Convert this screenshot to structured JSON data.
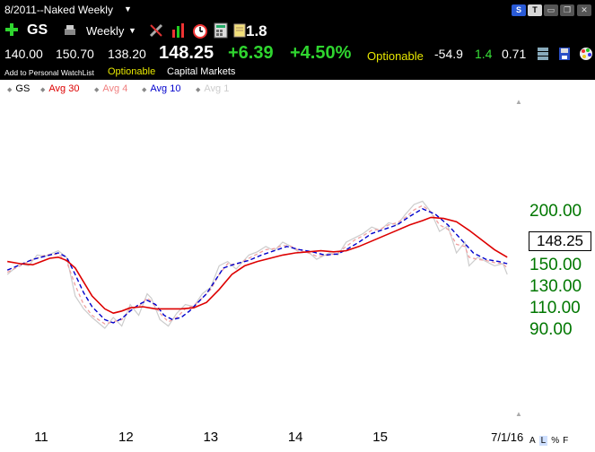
{
  "window": {
    "title": "8/2011--Naked Weekly"
  },
  "toolbar": {
    "symbol": "GS",
    "period": "Weekly",
    "rs_value": "1.8"
  },
  "quote": {
    "values": [
      "140.00",
      "150.70",
      "138.20"
    ],
    "last": "148.25",
    "change": "+6.39",
    "pct_change": "+4.50%",
    "optionable": "Optionable",
    "val1": "-54.9",
    "val2": "1.4",
    "val3": "0.71"
  },
  "watch": {
    "add_label": "Add to Personal WatchList",
    "optionable": "Optionable",
    "sector": "Capital Markets"
  },
  "legend": {
    "symbol": "GS",
    "avg30": "Avg 30",
    "avg4": "Avg 4",
    "avg10": "Avg 10",
    "avg1": "Avg 1"
  },
  "chart_controls": {
    "a": "A",
    "l": "L",
    "pct": "%",
    "f": "F"
  },
  "colors": {
    "avg30": "#dd0000",
    "avg10": "#0000cc",
    "avg4": "#f0a0a0",
    "avg1": "#cccccc",
    "axis_text": "#007700",
    "gain": "#2fd52f",
    "optionable": "#e8e800"
  },
  "chart_data": {
    "type": "line",
    "price_box": "148.25",
    "yticks": [
      {
        "value": 200,
        "label": "200.00"
      },
      {
        "value": 150,
        "label": "150.00"
      },
      {
        "value": 130,
        "label": "130.00"
      },
      {
        "value": 110,
        "label": "110.00"
      },
      {
        "value": 90,
        "label": "90.00"
      }
    ],
    "xticks": [
      {
        "x": 2011,
        "label": "11"
      },
      {
        "x": 2012,
        "label": "12"
      },
      {
        "x": 2013,
        "label": "13"
      },
      {
        "x": 2014,
        "label": "14"
      },
      {
        "x": 2015,
        "label": "15"
      },
      {
        "x": 2016.5,
        "label": "7/1/16"
      }
    ],
    "series": [
      {
        "name": "Avg 1",
        "key": "avg1",
        "points": [
          [
            2010.6,
            140
          ],
          [
            2010.75,
            150
          ],
          [
            2010.85,
            148
          ],
          [
            2010.95,
            158
          ],
          [
            2011.05,
            157
          ],
          [
            2011.2,
            162
          ],
          [
            2011.3,
            156
          ],
          [
            2011.4,
            120
          ],
          [
            2011.5,
            108
          ],
          [
            2011.6,
            100
          ],
          [
            2011.75,
            90
          ],
          [
            2011.85,
            100
          ],
          [
            2011.95,
            92
          ],
          [
            2012.05,
            112
          ],
          [
            2012.15,
            102
          ],
          [
            2012.25,
            122
          ],
          [
            2012.3,
            118
          ],
          [
            2012.4,
            98
          ],
          [
            2012.5,
            92
          ],
          [
            2012.6,
            104
          ],
          [
            2012.7,
            112
          ],
          [
            2012.8,
            110
          ],
          [
            2012.9,
            122
          ],
          [
            2013.0,
            128
          ],
          [
            2013.1,
            148
          ],
          [
            2013.2,
            152
          ],
          [
            2013.3,
            145
          ],
          [
            2013.45,
            158
          ],
          [
            2013.55,
            161
          ],
          [
            2013.65,
            166
          ],
          [
            2013.75,
            162
          ],
          [
            2013.85,
            170
          ],
          [
            2013.95,
            166
          ],
          [
            2014.05,
            160
          ],
          [
            2014.15,
            161
          ],
          [
            2014.25,
            154
          ],
          [
            2014.4,
            160
          ],
          [
            2014.5,
            158
          ],
          [
            2014.6,
            170
          ],
          [
            2014.7,
            174
          ],
          [
            2014.8,
            178
          ],
          [
            2014.9,
            184
          ],
          [
            2015.0,
            181
          ],
          [
            2015.1,
            188
          ],
          [
            2015.2,
            186
          ],
          [
            2015.3,
            196
          ],
          [
            2015.4,
            205
          ],
          [
            2015.5,
            208
          ],
          [
            2015.6,
            198
          ],
          [
            2015.7,
            180
          ],
          [
            2015.8,
            185
          ],
          [
            2015.9,
            160
          ],
          [
            2016.0,
            170
          ],
          [
            2016.05,
            148
          ],
          [
            2016.15,
            156
          ],
          [
            2016.25,
            152
          ],
          [
            2016.35,
            148
          ],
          [
            2016.45,
            150
          ],
          [
            2016.5,
            140
          ]
        ]
      },
      {
        "name": "Avg 4",
        "key": "avg4",
        "points": [
          [
            2010.6,
            142
          ],
          [
            2010.75,
            148
          ],
          [
            2010.85,
            152
          ],
          [
            2010.95,
            155
          ],
          [
            2011.05,
            158
          ],
          [
            2011.2,
            159
          ],
          [
            2011.3,
            152
          ],
          [
            2011.4,
            130
          ],
          [
            2011.5,
            112
          ],
          [
            2011.6,
            102
          ],
          [
            2011.75,
            94
          ],
          [
            2011.85,
            96
          ],
          [
            2011.95,
            98
          ],
          [
            2012.05,
            108
          ],
          [
            2012.15,
            110
          ],
          [
            2012.25,
            118
          ],
          [
            2012.3,
            115
          ],
          [
            2012.4,
            104
          ],
          [
            2012.5,
            96
          ],
          [
            2012.6,
            100
          ],
          [
            2012.7,
            108
          ],
          [
            2012.8,
            111
          ],
          [
            2012.9,
            118
          ],
          [
            2013.0,
            126
          ],
          [
            2013.1,
            140
          ],
          [
            2013.2,
            150
          ],
          [
            2013.3,
            149
          ],
          [
            2013.45,
            155
          ],
          [
            2013.55,
            159
          ],
          [
            2013.65,
            163
          ],
          [
            2013.75,
            164
          ],
          [
            2013.85,
            167
          ],
          [
            2013.95,
            166
          ],
          [
            2014.05,
            162
          ],
          [
            2014.15,
            160
          ],
          [
            2014.25,
            157
          ],
          [
            2014.4,
            158
          ],
          [
            2014.5,
            160
          ],
          [
            2014.6,
            166
          ],
          [
            2014.7,
            172
          ],
          [
            2014.8,
            176
          ],
          [
            2014.9,
            181
          ],
          [
            2015.0,
            182
          ],
          [
            2015.1,
            186
          ],
          [
            2015.2,
            188
          ],
          [
            2015.3,
            193
          ],
          [
            2015.4,
            200
          ],
          [
            2015.5,
            204
          ],
          [
            2015.6,
            198
          ],
          [
            2015.7,
            186
          ],
          [
            2015.8,
            182
          ],
          [
            2015.9,
            168
          ],
          [
            2016.0,
            166
          ],
          [
            2016.05,
            156
          ],
          [
            2016.15,
            154
          ],
          [
            2016.25,
            153
          ],
          [
            2016.35,
            151
          ],
          [
            2016.45,
            150
          ],
          [
            2016.5,
            146
          ]
        ]
      },
      {
        "name": "Avg 10",
        "key": "avg10",
        "points": [
          [
            2010.6,
            144
          ],
          [
            2010.75,
            149
          ],
          [
            2010.9,
            154
          ],
          [
            2011.05,
            157
          ],
          [
            2011.2,
            160
          ],
          [
            2011.3,
            156
          ],
          [
            2011.4,
            140
          ],
          [
            2011.5,
            123
          ],
          [
            2011.6,
            110
          ],
          [
            2011.75,
            98
          ],
          [
            2011.85,
            95
          ],
          [
            2011.95,
            99
          ],
          [
            2012.05,
            106
          ],
          [
            2012.15,
            112
          ],
          [
            2012.25,
            116
          ],
          [
            2012.35,
            112
          ],
          [
            2012.45,
            102
          ],
          [
            2012.55,
            98
          ],
          [
            2012.65,
            100
          ],
          [
            2012.75,
            106
          ],
          [
            2012.85,
            114
          ],
          [
            2012.95,
            122
          ],
          [
            2013.05,
            134
          ],
          [
            2013.15,
            146
          ],
          [
            2013.3,
            150
          ],
          [
            2013.45,
            153
          ],
          [
            2013.6,
            158
          ],
          [
            2013.75,
            162
          ],
          [
            2013.9,
            166
          ],
          [
            2014.05,
            163
          ],
          [
            2014.2,
            161
          ],
          [
            2014.35,
            158
          ],
          [
            2014.5,
            159
          ],
          [
            2014.6,
            163
          ],
          [
            2014.75,
            170
          ],
          [
            2014.9,
            178
          ],
          [
            2015.05,
            182
          ],
          [
            2015.2,
            186
          ],
          [
            2015.35,
            194
          ],
          [
            2015.5,
            201
          ],
          [
            2015.65,
            196
          ],
          [
            2015.8,
            186
          ],
          [
            2015.95,
            173
          ],
          [
            2016.1,
            160
          ],
          [
            2016.25,
            154
          ],
          [
            2016.4,
            152
          ],
          [
            2016.5,
            150
          ]
        ]
      },
      {
        "name": "Avg 30",
        "key": "avg30",
        "points": [
          [
            2010.6,
            152
          ],
          [
            2010.75,
            150
          ],
          [
            2010.9,
            149
          ],
          [
            2011.0,
            152
          ],
          [
            2011.1,
            155
          ],
          [
            2011.2,
            156
          ],
          [
            2011.3,
            153
          ],
          [
            2011.4,
            146
          ],
          [
            2011.5,
            133
          ],
          [
            2011.6,
            120
          ],
          [
            2011.75,
            108
          ],
          [
            2011.85,
            104
          ],
          [
            2011.95,
            106
          ],
          [
            2012.05,
            109
          ],
          [
            2012.2,
            110
          ],
          [
            2012.35,
            108
          ],
          [
            2012.5,
            108
          ],
          [
            2012.65,
            108
          ],
          [
            2012.8,
            109
          ],
          [
            2012.95,
            114
          ],
          [
            2013.1,
            126
          ],
          [
            2013.25,
            140
          ],
          [
            2013.4,
            148
          ],
          [
            2013.55,
            152
          ],
          [
            2013.7,
            155
          ],
          [
            2013.85,
            158
          ],
          [
            2014.0,
            160
          ],
          [
            2014.15,
            161
          ],
          [
            2014.3,
            162
          ],
          [
            2014.45,
            161
          ],
          [
            2014.6,
            162
          ],
          [
            2014.75,
            166
          ],
          [
            2014.9,
            171
          ],
          [
            2015.05,
            176
          ],
          [
            2015.2,
            181
          ],
          [
            2015.35,
            186
          ],
          [
            2015.5,
            190
          ],
          [
            2015.6,
            193
          ],
          [
            2015.75,
            192
          ],
          [
            2015.9,
            189
          ],
          [
            2016.05,
            181
          ],
          [
            2016.2,
            172
          ],
          [
            2016.35,
            163
          ],
          [
            2016.5,
            156
          ]
        ]
      }
    ]
  }
}
